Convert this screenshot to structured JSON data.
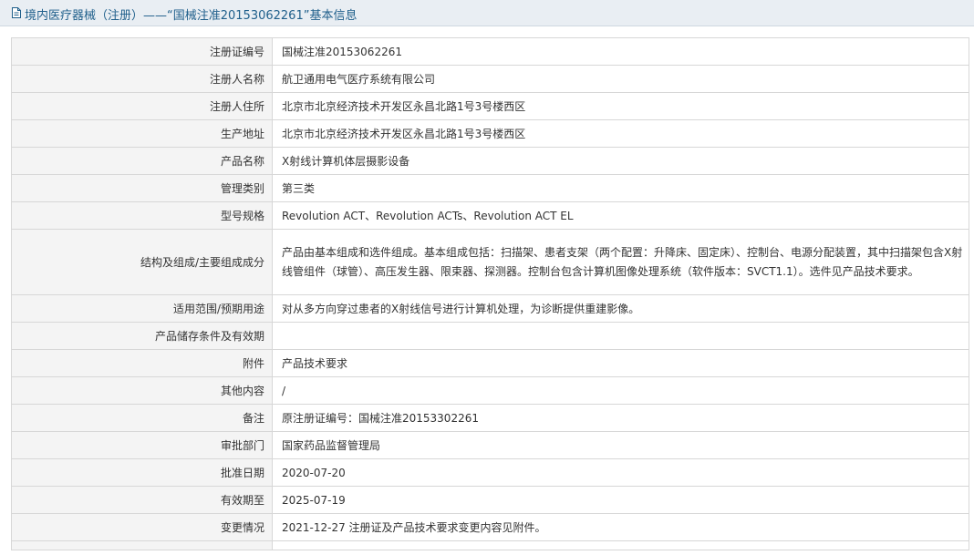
{
  "header": {
    "title": "境内医疗器械（注册）——“国械注准20153062261”基本信息"
  },
  "fields": [
    {
      "label": "注册证编号",
      "value": "国械注准20153062261"
    },
    {
      "label": "注册人名称",
      "value": "航卫通用电气医疗系统有限公司"
    },
    {
      "label": "注册人住所",
      "value": "北京市北京经济技术开发区永昌北路1号3号楼西区"
    },
    {
      "label": "生产地址",
      "value": "北京市北京经济技术开发区永昌北路1号3号楼西区"
    },
    {
      "label": "产品名称",
      "value": "X射线计算机体层摄影设备"
    },
    {
      "label": "管理类别",
      "value": "第三类"
    },
    {
      "label": "型号规格",
      "value": "Revolution ACT、Revolution ACTs、Revolution ACT EL"
    },
    {
      "label": "结构及组成/主要组成成分",
      "value": "产品由基本组成和选件组成。基本组成包括：扫描架、患者支架（两个配置：升降床、固定床）、控制台、电源分配装置，其中扫描架包含X射线管组件（球管）、高压发生器、限束器、探测器。控制台包含计算机图像处理系统（软件版本：SVCT1.1）。选件见产品技术要求。"
    },
    {
      "label": "适用范围/预期用途",
      "value": "对从多方向穿过患者的X射线信号进行计算机处理，为诊断提供重建影像。"
    },
    {
      "label": "产品储存条件及有效期",
      "value": ""
    },
    {
      "label": "附件",
      "value": "产品技术要求"
    },
    {
      "label": "其他内容",
      "value": "/"
    },
    {
      "label": "备注",
      "value": "原注册证编号：国械注准20153302261"
    },
    {
      "label": "审批部门",
      "value": "国家药品监督管理局"
    },
    {
      "label": "批准日期",
      "value": "2020-07-20"
    },
    {
      "label": "有效期至",
      "value": "2025-07-19"
    },
    {
      "label": "变更情况",
      "value": "2021-12-27 注册证及产品技术要求变更内容见附件。"
    }
  ]
}
